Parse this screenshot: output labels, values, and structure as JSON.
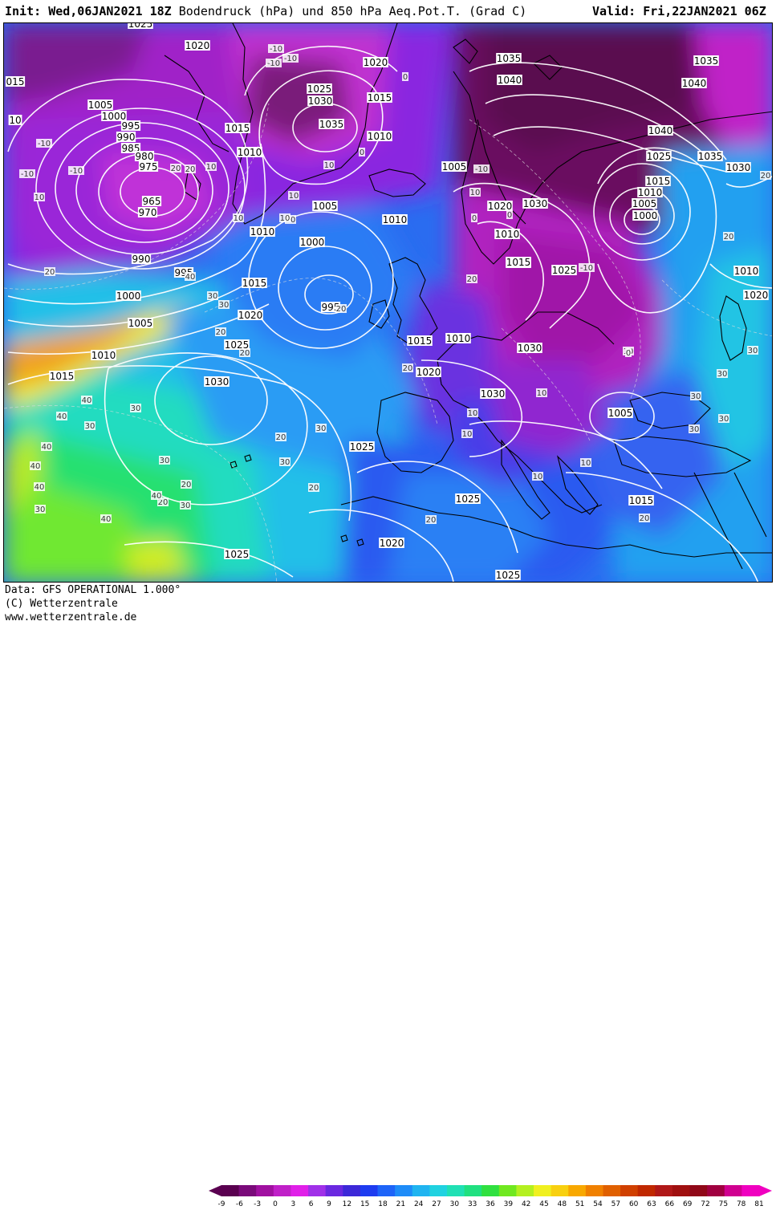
{
  "header": {
    "init_label": "Init:",
    "init_value": "Wed,06JAN2021 18Z",
    "title": "Bodendruck (hPa) und 850 hPa Aeq.Pot.T. (Grad C)",
    "valid_label": "Valid:",
    "valid_value": "Fri,22JAN2021 06Z"
  },
  "footer": {
    "data_line": "Data: GFS OPERATIONAL 1.000°",
    "copyright_line": "(C) Wetterzentrale",
    "url_line": "www.wetterzentrale.de"
  },
  "colorbar": {
    "ticks": [
      "-9",
      "-6",
      "-3",
      "0",
      "3",
      "6",
      "9",
      "12",
      "15",
      "18",
      "21",
      "24",
      "27",
      "30",
      "33",
      "36",
      "39",
      "42",
      "45",
      "48",
      "51",
      "54",
      "57",
      "60",
      "63",
      "66",
      "69",
      "72",
      "75",
      "78",
      "81"
    ],
    "colors": [
      "#5a0050",
      "#7a0a7a",
      "#a010a0",
      "#c020c8",
      "#e020e8",
      "#a030e8",
      "#6a28e0",
      "#3c28d8",
      "#1e3cf0",
      "#1e64f8",
      "#1e8cf8",
      "#20b4f0",
      "#20d2e0",
      "#20e0b4",
      "#20e080",
      "#30e040",
      "#70e820",
      "#b4f020",
      "#f0f020",
      "#f8d010",
      "#f8a800",
      "#f08000",
      "#e06000",
      "#d04000",
      "#c02800",
      "#b01818",
      "#a01010",
      "#900818",
      "#a00040",
      "#d00090",
      "#f000c0"
    ],
    "colors_note": "temperature scale from dark purple (-9) through blue, cyan, green, yellow, orange, red to magenta (81)"
  },
  "isobars": [
    "1025",
    "1020",
    "1015",
    "1010",
    "1005",
    "1000",
    "995",
    "990",
    "985",
    "980",
    "975",
    "970",
    "965",
    "1035",
    "1040",
    "1030"
  ],
  "pressure_labels": [
    {
      "t": "1025"
    },
    {
      "t": "1020"
    },
    {
      "t": "1020"
    },
    {
      "t": "1025"
    },
    {
      "t": "1030"
    },
    {
      "t": "1015"
    },
    {
      "t": "1035"
    },
    {
      "t": "1040"
    },
    {
      "t": "1035"
    },
    {
      "t": "1040"
    },
    {
      "t": "1015"
    },
    {
      "t": "1010"
    },
    {
      "t": "1005"
    },
    {
      "t": "1000"
    },
    {
      "t": "995"
    },
    {
      "t": "990"
    },
    {
      "t": "985"
    },
    {
      "t": "980"
    },
    {
      "t": "975"
    },
    {
      "t": "965"
    },
    {
      "t": "970"
    },
    {
      "t": "1010"
    },
    {
      "t": "1035"
    },
    {
      "t": "1005"
    },
    {
      "t": "1040"
    },
    {
      "t": "1025"
    },
    {
      "t": "1035"
    },
    {
      "t": "1030"
    },
    {
      "t": "1015"
    },
    {
      "t": "1010"
    },
    {
      "t": "1005"
    },
    {
      "t": "1000"
    },
    {
      "t": "1020"
    },
    {
      "t": "1030"
    },
    {
      "t": "1010"
    },
    {
      "t": "1015"
    },
    {
      "t": "1025"
    },
    {
      "t": "1005"
    },
    {
      "t": "1010"
    },
    {
      "t": "1010"
    },
    {
      "t": "1000"
    },
    {
      "t": "990"
    },
    {
      "t": "995"
    },
    {
      "t": "1000"
    },
    {
      "t": "1005"
    },
    {
      "t": "1010"
    },
    {
      "t": "1015"
    },
    {
      "t": "1015"
    },
    {
      "t": "995"
    },
    {
      "t": "1020"
    },
    {
      "t": "1025"
    },
    {
      "t": "1015"
    },
    {
      "t": "1010"
    },
    {
      "t": "1020"
    },
    {
      "t": "1030"
    },
    {
      "t": "1030"
    },
    {
      "t": "1030"
    },
    {
      "t": "1010"
    },
    {
      "t": "1020"
    },
    {
      "t": "1005"
    },
    {
      "t": "1025"
    },
    {
      "t": "1025"
    },
    {
      "t": "1015"
    },
    {
      "t": "1020"
    },
    {
      "t": "1025"
    },
    {
      "t": "1025"
    },
    {
      "t": "1015"
    },
    {
      "t": "015"
    },
    {
      "t": "10"
    }
  ],
  "temp_labels": [
    "20",
    "20",
    "10",
    "10",
    "10",
    "0",
    "-10",
    "-10",
    "-10",
    "10",
    "20",
    "40",
    "30",
    "30",
    "20",
    "20",
    "40",
    "30",
    "30",
    "40",
    "40",
    "40",
    "40",
    "30",
    "30",
    "20",
    "20",
    "30",
    "20",
    "10",
    "10",
    "20",
    "20",
    "10",
    "20",
    "30",
    "30",
    "40",
    "40",
    "20",
    "-10",
    "10",
    "10",
    "20",
    "20",
    "30",
    "30",
    "30",
    "20",
    "10",
    "-10",
    "-10",
    "-10",
    "0",
    "0",
    "0",
    "0",
    "-10",
    "10",
    "10",
    "10",
    "20",
    "20",
    "30",
    "30",
    "30"
  ],
  "colors": {
    "isobar": "#ffffff",
    "coastline": "#000000",
    "label_bg": "#ffffff"
  }
}
